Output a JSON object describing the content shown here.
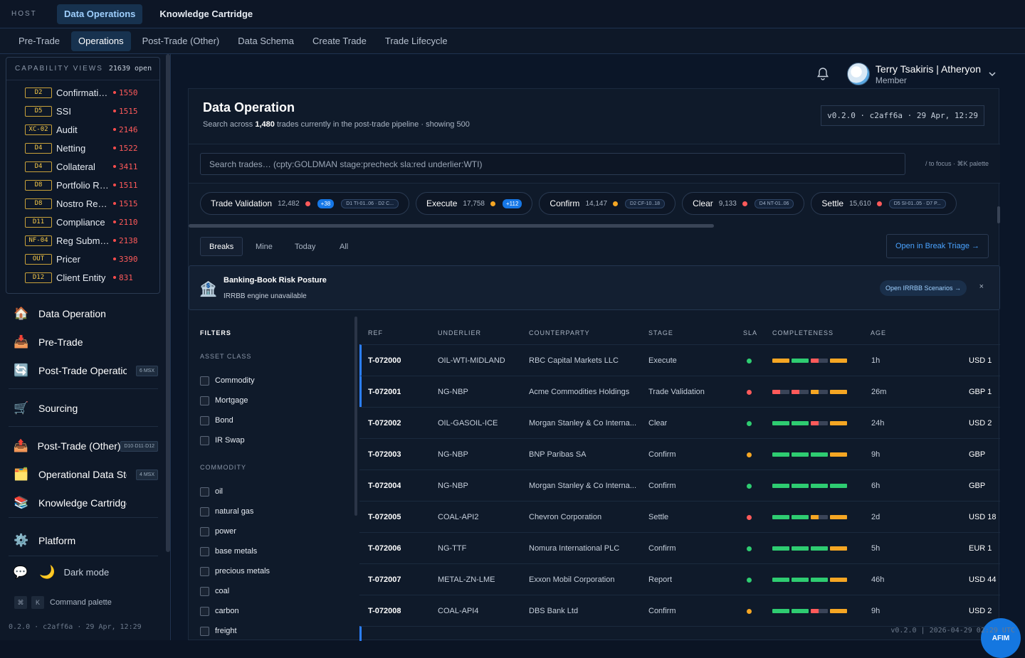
{
  "host": {
    "label": "HOST",
    "tabs": [
      {
        "label": "Data Operations",
        "active": true
      },
      {
        "label": "Knowledge Cartridge",
        "active": false
      }
    ]
  },
  "subnav": {
    "tabs": [
      {
        "label": "Pre-Trade",
        "active": false
      },
      {
        "label": "Operations",
        "active": true
      },
      {
        "label": "Post-Trade (Other)",
        "active": false
      },
      {
        "label": "Data Schema",
        "active": false
      },
      {
        "label": "Create Trade",
        "active": false
      },
      {
        "label": "Trade Lifecycle",
        "active": false
      }
    ]
  },
  "capability": {
    "title": "CAPABILITY VIEWS",
    "count": "21639 open",
    "items": [
      {
        "badge": "D2",
        "label": "Confirmations",
        "count": "1550"
      },
      {
        "badge": "D5",
        "label": "SSI",
        "count": "1515"
      },
      {
        "badge": "XC-02",
        "label": "Audit",
        "count": "2146"
      },
      {
        "badge": "D4",
        "label": "Netting",
        "count": "1522"
      },
      {
        "badge": "D4",
        "label": "Collateral",
        "count": "3411"
      },
      {
        "badge": "D8",
        "label": "Portfolio Reconciliation",
        "count": "1511"
      },
      {
        "badge": "D8",
        "label": "Nostro Reconciliation",
        "count": "1515"
      },
      {
        "badge": "D11",
        "label": "Compliance",
        "count": "2110"
      },
      {
        "badge": "NF-04",
        "label": "Reg Submissions",
        "count": "2138"
      },
      {
        "badge": "OUT",
        "label": "Pricer",
        "count": "3390"
      },
      {
        "badge": "D12",
        "label": "Client Entity",
        "count": "831"
      }
    ]
  },
  "nav": {
    "items": [
      {
        "icon": "house-icon",
        "label": "Data Operation",
        "tag": ""
      },
      {
        "icon": "inbox-tray-icon",
        "label": "Pre-Trade",
        "tag": ""
      },
      {
        "icon": "refresh-icon",
        "label": "Post-Trade Operations",
        "tag": "6 MSX"
      },
      {
        "icon": "cart-icon",
        "label": "Sourcing",
        "tag": ""
      },
      {
        "icon": "outbox-tray-icon",
        "label": "Post-Trade (Other)",
        "tag": "D10·D11·D12"
      },
      {
        "icon": "folder-icon",
        "label": "Operational Data Store",
        "tag": "4 MSX"
      },
      {
        "icon": "books-icon",
        "label": "Knowledge Cartridge",
        "tag": ""
      },
      {
        "icon": "gear-icon",
        "label": "Platform",
        "tag": ""
      }
    ],
    "dark_mode": "Dark mode",
    "command_palette": "Command palette",
    "kbd": [
      "⌘",
      "K"
    ],
    "version": "0.2.0 · c2aff6a · 29 Apr, 12:29"
  },
  "user": {
    "name": "Terry Tsakiris | Atheryon",
    "role": "Member"
  },
  "panel": {
    "title": "Data Operation",
    "subtitle_pre": "Search across ",
    "subtitle_count": "1,480",
    "subtitle_post": " trades currently in the post-trade pipeline · showing 500",
    "version": "v0.2.0 · c2aff6a · 29 Apr, 12:29"
  },
  "search": {
    "placeholder": "Search trades… (cpty:GOLDMAN stage:precheck sla:red underlier:WTI)",
    "hint": "/ to focus · ⌘K palette"
  },
  "stages": [
    {
      "name": "Trade Validation",
      "count": "12,482",
      "dot": "#ff5a5a",
      "plus": "+38",
      "ref": "D1 TI-01..06 · D2 C..."
    },
    {
      "name": "Execute",
      "count": "17,758",
      "dot": "#f5a623",
      "plus": "+112",
      "ref": ""
    },
    {
      "name": "Confirm",
      "count": "14,147",
      "dot": "#f5a623",
      "plus": "",
      "ref": "D2 CF-10..18"
    },
    {
      "name": "Clear",
      "count": "9,133",
      "dot": "#ff5a5a",
      "plus": "",
      "ref": "D4 NT-01..06"
    },
    {
      "name": "Settle",
      "count": "15,610",
      "dot": "#ff5a5a",
      "plus": "",
      "ref": "D5 SI-01..05 · D7 P..."
    }
  ],
  "view_tabs": [
    {
      "label": "Breaks",
      "active": true
    },
    {
      "label": "Mine",
      "active": false
    },
    {
      "label": "Today",
      "active": false
    },
    {
      "label": "All",
      "active": false
    }
  ],
  "open_triage": "Open in Break Triage →",
  "banner": {
    "title": "Banking-Book Risk Posture",
    "subtitle": "IRRBB engine unavailable",
    "button": "Open IRRBB Scenarios →",
    "close": "×"
  },
  "filters": {
    "title": "FILTERS",
    "asset_class_title": "ASSET CLASS",
    "asset_class": [
      "Commodity",
      "Mortgage",
      "Bond",
      "IR Swap"
    ],
    "commodity_title": "COMMODITY",
    "commodity": [
      "oil",
      "natural gas",
      "power",
      "base metals",
      "precious metals",
      "coal",
      "carbon",
      "freight"
    ]
  },
  "table": {
    "headers": [
      "REF",
      "UNDERLIER",
      "COUNTERPARTY",
      "STAGE",
      "SLA",
      "COMPLETENESS",
      "AGE"
    ],
    "rows": [
      {
        "ref": "T-072000",
        "underlier": "OIL-WTI-MIDLAND",
        "cpty": "RBC Capital Markets LLC",
        "stage": "Execute",
        "sla": "#2ecc71",
        "comp": [
          "#f5a623",
          "#2ecc71",
          "#ff5a5a|#3a4458",
          "#f5a623"
        ],
        "age": "1h",
        "ccy": "USD 1",
        "sel": true
      },
      {
        "ref": "T-072001",
        "underlier": "NG-NBP",
        "cpty": "Acme Commodities Holdings",
        "stage": "Trade Validation",
        "sla": "#ff5a5a",
        "comp": [
          "#ff5a5a|#3a4458",
          "#ff5a5a|#3a4458",
          "#f5a623|#3a4458",
          "#f5a623"
        ],
        "age": "26m",
        "ccy": "GBP 1",
        "sel": true
      },
      {
        "ref": "T-072002",
        "underlier": "OIL-GASOIL-ICE",
        "cpty": "Morgan Stanley & Co Interna...",
        "stage": "Clear",
        "sla": "#2ecc71",
        "comp": [
          "#2ecc71",
          "#2ecc71",
          "#ff5a5a|#3a4458",
          "#f5a623"
        ],
        "age": "24h",
        "ccy": "USD 2",
        "sel": false
      },
      {
        "ref": "T-072003",
        "underlier": "NG-NBP",
        "cpty": "BNP Paribas SA",
        "stage": "Confirm",
        "sla": "#f5a623",
        "comp": [
          "#2ecc71",
          "#2ecc71",
          "#2ecc71",
          "#f5a623"
        ],
        "age": "9h",
        "ccy": "GBP",
        "sel": false
      },
      {
        "ref": "T-072004",
        "underlier": "NG-NBP",
        "cpty": "Morgan Stanley & Co Interna...",
        "stage": "Confirm",
        "sla": "#2ecc71",
        "comp": [
          "#2ecc71",
          "#2ecc71",
          "#2ecc71",
          "#2ecc71"
        ],
        "age": "6h",
        "ccy": "GBP",
        "sel": false
      },
      {
        "ref": "T-072005",
        "underlier": "COAL-API2",
        "cpty": "Chevron Corporation",
        "stage": "Settle",
        "sla": "#ff5a5a",
        "comp": [
          "#2ecc71",
          "#2ecc71",
          "#f5a623|#3a4458",
          "#f5a623"
        ],
        "age": "2d",
        "ccy": "USD 18",
        "sel": false
      },
      {
        "ref": "T-072006",
        "underlier": "NG-TTF",
        "cpty": "Nomura International PLC",
        "stage": "Confirm",
        "sla": "#2ecc71",
        "comp": [
          "#2ecc71",
          "#2ecc71",
          "#2ecc71",
          "#f5a623"
        ],
        "age": "5h",
        "ccy": "EUR 1",
        "sel": false
      },
      {
        "ref": "T-072007",
        "underlier": "METAL-ZN-LME",
        "cpty": "Exxon Mobil Corporation",
        "stage": "Report",
        "sla": "#2ecc71",
        "comp": [
          "#2ecc71",
          "#2ecc71",
          "#2ecc71",
          "#f5a623"
        ],
        "age": "46h",
        "ccy": "USD 44",
        "sel": false
      },
      {
        "ref": "T-072008",
        "underlier": "COAL-API4",
        "cpty": "DBS Bank Ltd",
        "stage": "Confirm",
        "sla": "#f5a623",
        "comp": [
          "#2ecc71",
          "#2ecc71",
          "#ff5a5a|#3a4458",
          "#f5a623"
        ],
        "age": "9h",
        "ccy": "USD 2",
        "sel": false
      }
    ]
  },
  "afim": "AFIM",
  "footer_version": "v0.2.0 | 2026-04-29 02:29 UTC"
}
